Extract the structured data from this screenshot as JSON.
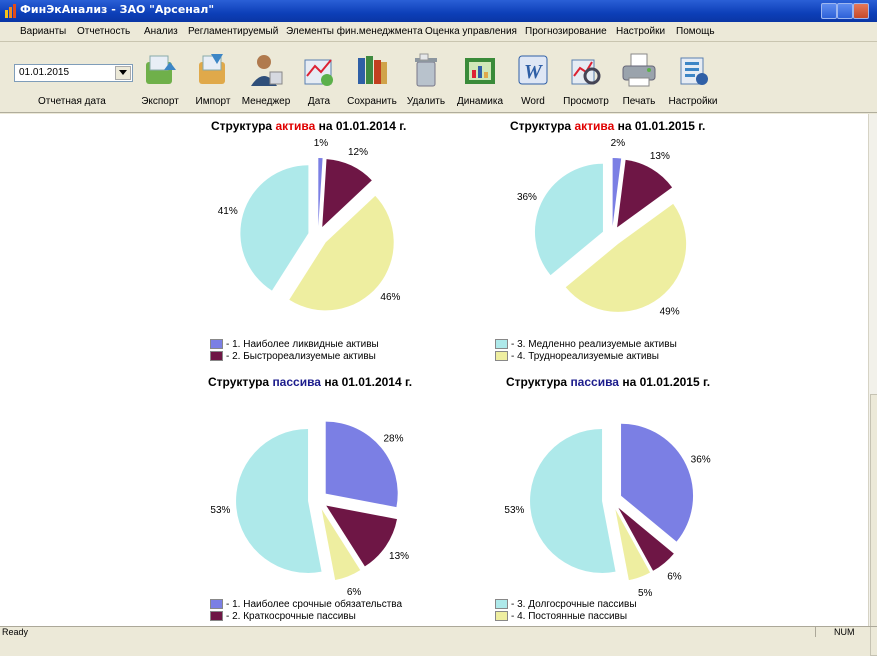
{
  "window": {
    "title": "ФинЭкАнализ - ЗАО \"Арсенал\""
  },
  "menu": [
    "Варианты",
    "Отчетность",
    "Анализ",
    "Регламентируемый",
    "Элементы фин.менеджмента",
    "Оценка управления",
    "Прогнозирование",
    "Настройки",
    "Помощь"
  ],
  "toolbar": {
    "date_value": "01.01.2015",
    "date_label": "Отчетная дата",
    "buttons": [
      "Экспорт",
      "Импорт",
      "Менеджер",
      "Дата",
      "Сохранить",
      "Удалить",
      "Динамика",
      "Word",
      "Просмотр",
      "Печать",
      "Настройки"
    ]
  },
  "status": {
    "ready": "Ready",
    "num": "NUM"
  },
  "colors": {
    "c1": "#7b7fe4",
    "c2": "#6e1645",
    "c3": "#aee9ea",
    "c4": "#eeeea0"
  },
  "charts": {
    "asset_2014": {
      "prefix": "Структура ",
      "highlight": "актива",
      "suffix": " на 01.01.2014 г."
    },
    "asset_2015": {
      "prefix": "Структура ",
      "highlight": "актива",
      "suffix": " на 01.01.2015 г."
    },
    "liab_2014": {
      "prefix": "Структура ",
      "highlight": "пассива",
      "suffix": " на 01.01.2014 г."
    },
    "liab_2015": {
      "prefix": "Структура ",
      "highlight": "пассива",
      "suffix": " на 01.01.2015 г."
    }
  },
  "legends": {
    "asset_left": [
      "- 1. Наиболее ликвидные активы",
      "- 2. Быстрореализуемые активы"
    ],
    "asset_right": [
      "- 3. Медленно реализуемые активы",
      "- 4. Труднореализуемые активы"
    ],
    "liab_left": [
      "- 1. Наиболее срочные обязательства",
      "- 2. Краткосрочные пассивы"
    ],
    "liab_right": [
      "- 3. Долгосрочные пассивы",
      "- 4. Постоянные пассивы"
    ]
  },
  "chart_data": [
    {
      "type": "pie",
      "title": "Структура актива на 01.01.2014 г.",
      "labels": [
        "1. Наиболее ликвидные активы",
        "2. Быстрореализуемые активы",
        "4. Труднореализуемые активы",
        "3. Медленно реализуемые активы"
      ],
      "values": [
        1,
        12,
        46,
        41
      ],
      "value_labels": [
        "1%",
        "12%",
        "46%",
        "41%"
      ]
    },
    {
      "type": "pie",
      "title": "Структура актива на 01.01.2015 г.",
      "labels": [
        "1. Наиболее ликвидные активы",
        "2. Быстрореализуемые активы",
        "4. Труднореализуемые активы",
        "3. Медленно реализуемые активы"
      ],
      "values": [
        2,
        13,
        49,
        36
      ],
      "value_labels": [
        "2%",
        "13%",
        "49%",
        "36%"
      ]
    },
    {
      "type": "pie",
      "title": "Структура пассива на 01.01.2014 г.",
      "labels": [
        "1. Наиболее срочные обязательства",
        "2. Краткосрочные пассивы",
        "4. Постоянные пассивы",
        "3. Долгосрочные пассивы"
      ],
      "values": [
        28,
        13,
        6,
        53
      ],
      "value_labels": [
        "28%",
        "13%",
        "6%",
        "53%"
      ]
    },
    {
      "type": "pie",
      "title": "Структура пассива на 01.01.2015 г.",
      "labels": [
        "1. Наиболее срочные обязательства",
        "2. Краткосрочные пассивы",
        "4. Постоянные пассивы",
        "3. Долгосрочные пассивы"
      ],
      "values": [
        36,
        6,
        5,
        53
      ],
      "value_labels": [
        "36%",
        "6%",
        "5%",
        "53%"
      ]
    }
  ]
}
